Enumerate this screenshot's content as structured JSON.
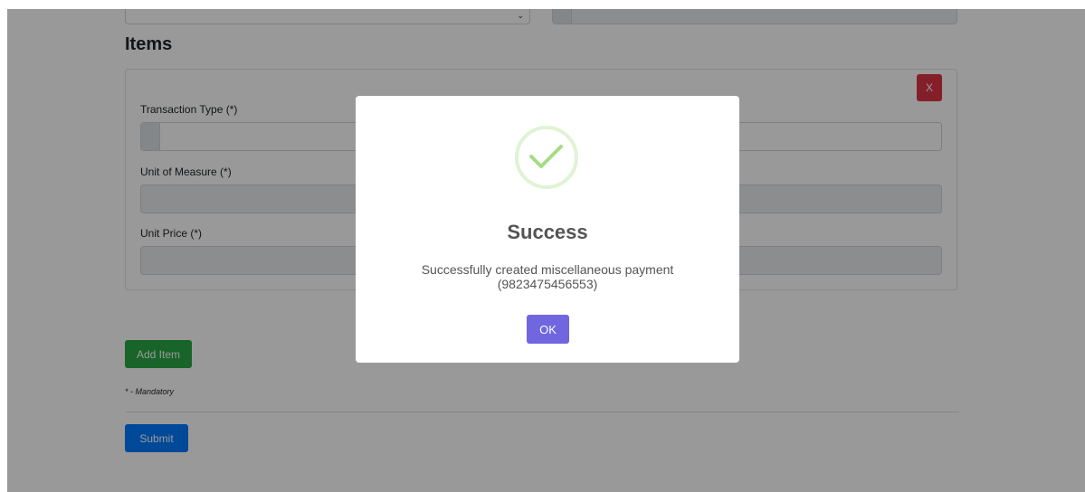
{
  "form": {
    "items_heading": "Items",
    "remove_item_label": "X",
    "fields": {
      "transaction_type_label": "Transaction Type (*)",
      "unit_of_measure_label": "Unit of Measure (*)",
      "unit_price_label": "Unit Price (*)"
    },
    "add_item_label": "Add Item",
    "mandatory_note": "* - Mandatory",
    "submit_label": "Submit"
  },
  "modal": {
    "icon": "check-icon",
    "title": "Success",
    "message": "Successfully created miscellaneous payment (9823475456553)",
    "ok_label": "OK"
  },
  "colors": {
    "overlay": "rgba(0,0,0,0.4)",
    "remove_button": "#dc3545",
    "add_item_button": "#28a745",
    "submit_button": "#007bff",
    "ok_button": "#7066e0",
    "success_check": "#a5dc86"
  }
}
